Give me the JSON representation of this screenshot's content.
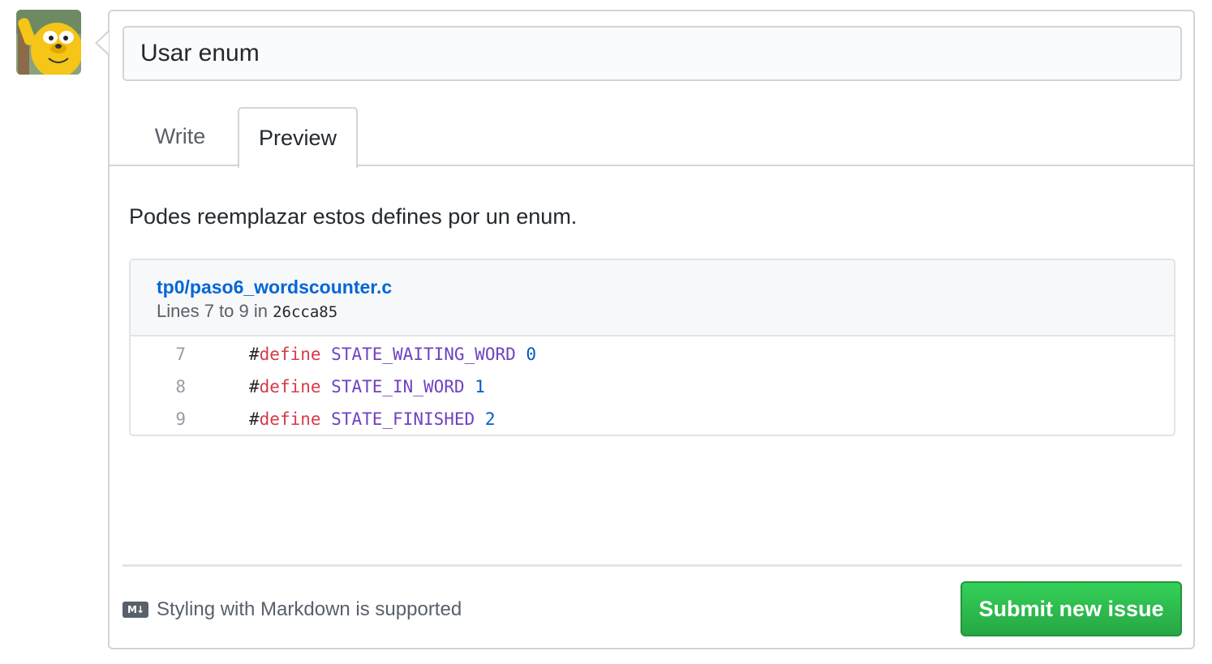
{
  "user": {
    "avatar_icon": "jake-avatar-icon"
  },
  "issue": {
    "title_value": "Usar enum"
  },
  "tabs": [
    {
      "label": "Write",
      "active": false
    },
    {
      "label": "Preview",
      "active": true
    }
  ],
  "preview": {
    "text": "Podes reemplazar estos defines por un enum.",
    "snippet": {
      "path": "tp0/paso6_wordscounter.c",
      "lines_prefix": "Lines 7 to 9 in ",
      "sha": "26cca85",
      "rows": [
        {
          "line": "7",
          "hash": "#",
          "keyword": "define",
          "name": "STATE_WAITING_WORD",
          "value": "0"
        },
        {
          "line": "8",
          "hash": "#",
          "keyword": "define",
          "name": "STATE_IN_WORD",
          "value": "1"
        },
        {
          "line": "9",
          "hash": "#",
          "keyword": "define",
          "name": "STATE_FINISHED",
          "value": "2"
        }
      ]
    }
  },
  "footer": {
    "markdown_icon_label": "M↓",
    "markdown_text": "Styling with Markdown is supported",
    "submit_label": "Submit new issue"
  },
  "colors": {
    "link": "#0366d6",
    "submit_green": "#28a745",
    "keyword": "#d73a49",
    "identifier": "#6f42c1",
    "number": "#005cc5"
  }
}
